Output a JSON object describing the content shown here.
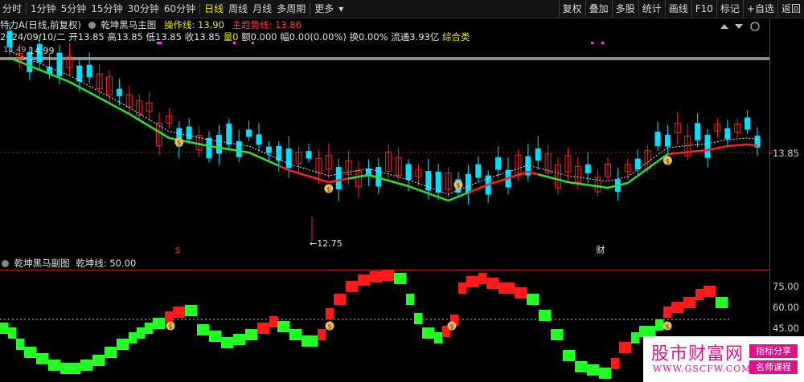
{
  "periods": [
    "分时",
    "1分钟",
    "5分钟",
    "15分钟",
    "30分钟",
    "60分钟",
    "日线",
    "周线",
    "月线",
    "多周期",
    "更多"
  ],
  "active_period": "日线",
  "more_arrow": "▾",
  "tools": [
    "复权",
    "叠加",
    "多股",
    "统计",
    "画线",
    "F10",
    "标记",
    "+自选",
    "返回"
  ],
  "stock_title": "特力A(日线,前复权)",
  "indicator_name": "乾坤黑马主图",
  "op_line_label": "操作线: 13.90",
  "main_line_label": "主趋势线: 13.86",
  "date_label": "2024/09/10/二",
  "quote": {
    "open": "开13.85",
    "high": "高13.85",
    "low": "低13.85",
    "close": "收13.85",
    "vol": "量0",
    "amount": "额0.000",
    "amp": "幅0.00(0.00%)",
    "turnover": "换0.00%",
    "float": "流通3.93亿",
    "sector": "综合类"
  },
  "price_axis_label": "13.85",
  "high_marker": "14.99",
  "high_marker_left": "14.49",
  "low_marker": "12.75",
  "low_arrow": "←",
  "event_marks": [
    "$",
    "财"
  ],
  "sub_indicator_name": "乾坤黑马副图",
  "sub_line_label": "乾坤线: 50.00",
  "sub_axis": [
    "75.00",
    "60.00",
    "45.00"
  ],
  "watermark": {
    "cn": "股市财富网",
    "url": "WWW.GSCFW.COM",
    "tag1": "指标分享",
    "tag2": "名师课程"
  },
  "colors": {
    "up": "#ff2020",
    "down": "#00e0ff",
    "trend_up": "#ff2020",
    "trend_down": "#30e030",
    "bg": "#000000",
    "active": "#e8e800"
  },
  "icons": [
    "indicator-toggle-icon",
    "sub-indicator-toggle-icon",
    "panel-up-icon",
    "panel-down-icon",
    "panel-close-icon",
    "buy-signal-icon"
  ]
}
